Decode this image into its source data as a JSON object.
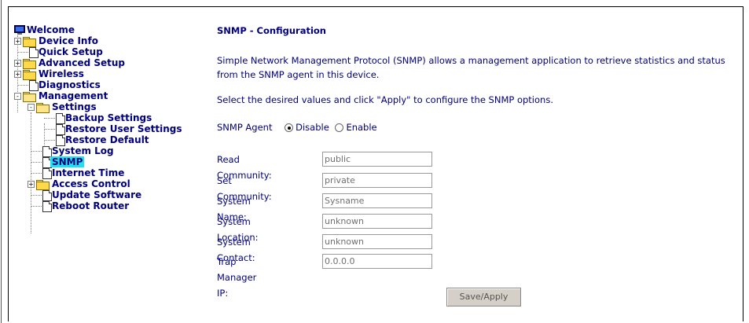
{
  "sidebar": {
    "items": [
      {
        "label": "Welcome",
        "icon": "monitor-icon",
        "expander": ""
      },
      {
        "label": "Device Info",
        "icon": "folder-icon",
        "expander": "+"
      },
      {
        "label": "Quick Setup",
        "icon": "page-icon",
        "expander": ""
      },
      {
        "label": "Advanced Setup",
        "icon": "folder-icon",
        "expander": "+"
      },
      {
        "label": "Wireless",
        "icon": "folder-icon",
        "expander": "+"
      },
      {
        "label": "Diagnostics",
        "icon": "page-icon",
        "expander": ""
      },
      {
        "label": "Management",
        "icon": "open-folder-icon",
        "expander": "-"
      },
      {
        "label": "Settings",
        "icon": "open-folder-icon",
        "expander": "-"
      },
      {
        "label": "Backup Settings",
        "icon": "page-icon",
        "expander": ""
      },
      {
        "label": "Restore User Settings",
        "icon": "page-icon",
        "expander": ""
      },
      {
        "label": "Restore Default",
        "icon": "page-icon",
        "expander": ""
      },
      {
        "label": "System Log",
        "icon": "page-icon",
        "expander": ""
      },
      {
        "label": "SNMP",
        "icon": "page-icon",
        "expander": "",
        "selected": true
      },
      {
        "label": "Internet Time",
        "icon": "page-icon",
        "expander": ""
      },
      {
        "label": "Access Control",
        "icon": "folder-icon",
        "expander": "+"
      },
      {
        "label": "Update Software",
        "icon": "page-icon",
        "expander": ""
      },
      {
        "label": "Reboot Router",
        "icon": "page-icon",
        "expander": ""
      }
    ]
  },
  "main": {
    "title": "SNMP - Configuration",
    "description": "Simple Network Management Protocol (SNMP) allows a management application to retrieve statistics and status from the SNMP agent in this device.",
    "instruction": "Select the desired values and click \"Apply\" to configure the SNMP options.",
    "agent": {
      "label": "SNMP Agent",
      "options": [
        "Disable",
        "Enable"
      ],
      "selected": "Disable"
    },
    "fields": [
      {
        "label": "Read Community:",
        "value": "public"
      },
      {
        "label": "Set Community:",
        "value": "private"
      },
      {
        "label": "System Name:",
        "value": "Sysname"
      },
      {
        "label": "System Location:",
        "value": "unknown"
      },
      {
        "label": "System Contact:",
        "value": "unknown"
      },
      {
        "label": "Trap Manager IP:",
        "value": "0.0.0.0"
      }
    ],
    "save_label": "Save/Apply"
  },
  "colors": {
    "text": "#000080",
    "selected_bg": "#1fe0f0",
    "folder": "#FFD94A"
  }
}
